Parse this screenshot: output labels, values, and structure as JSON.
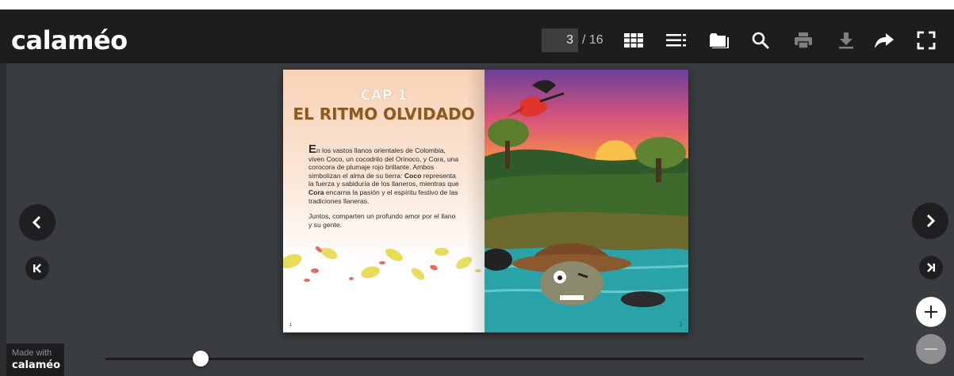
{
  "app": {
    "logo": "calaméo"
  },
  "toolbar": {
    "current_page": "3",
    "total_pages": "/ 16",
    "icons": [
      "grid-view-icon",
      "table-of-contents-icon",
      "library-icon",
      "search-icon",
      "print-icon",
      "download-icon",
      "share-icon",
      "fullscreen-icon"
    ]
  },
  "book": {
    "left_page": {
      "cap_label": "CAP 1",
      "title": "EL RITMO OLVIDADO",
      "dropcap": "E",
      "paragraph1_a": "n los vastos llanos orientales de Colombia, viven Coco, un cocodrilo del Orinoco, y Cora, una corocora de plumaje rojo brillante. Ambos simbolizan el alma de su tierra: ",
      "paragraph1_coco": "Coco",
      "paragraph1_b": " representa la fuerza y sabiduría de los llaneros, mientras que ",
      "paragraph1_cora": "Cora",
      "paragraph1_c": " encarna la pasión y el espíritu festivo de las tradiciones llaneras.",
      "paragraph2": "Juntos, comparten un profundo amor por el llano y su gente.",
      "page_number": "1"
    },
    "right_page": {
      "page_number": "2"
    }
  },
  "navigation": {
    "prev_icon": "chevron-left-icon",
    "next_icon": "chevron-right-icon",
    "first_icon": "first-page-icon",
    "last_icon": "last-page-icon",
    "zoom_in_icon": "plus-icon",
    "zoom_out_icon": "minus-icon",
    "slider_position_fraction": 0.125
  },
  "footer": {
    "made_with": "Made with",
    "brand": "calaméo"
  },
  "colors": {
    "toolbar_bg": "#1c1d1e",
    "stage_bg": "#3a3d3f",
    "title_brown": "#8a5a24"
  }
}
